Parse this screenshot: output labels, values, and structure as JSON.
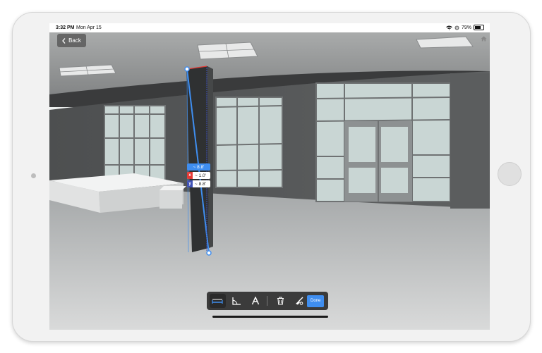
{
  "statusbar": {
    "time": "3:32 PM",
    "date": "Mon Apr 15",
    "battery": "79%",
    "icons": [
      "wifi-icon",
      "rotation-lock-icon",
      "battery-icon"
    ]
  },
  "back_button": {
    "label": "Back",
    "icon": "chevron-left-icon"
  },
  "measurement": {
    "total": "~ 8.8'",
    "axes": [
      {
        "axis": "x",
        "value": "~ 1.0'",
        "color": "#e53935"
      },
      {
        "axis": "y",
        "value": "~ 8.8'",
        "color": "#3f51b5"
      }
    ]
  },
  "toolbar": {
    "tools": [
      {
        "name": "distance-tool",
        "icon": "ruler-icon",
        "active": true
      },
      {
        "name": "angle-tool",
        "icon": "angle-icon",
        "active": false
      },
      {
        "name": "annotation-tool",
        "icon": "text-a-icon",
        "active": false
      },
      {
        "name": "delete-tool",
        "icon": "trash-icon",
        "active": false
      },
      {
        "name": "clear-all-tool",
        "icon": "broom-icon",
        "active": false
      }
    ],
    "done_label": "Done"
  },
  "colors": {
    "accent": "#3f8ef0",
    "toolbar": "#3b3b3b"
  }
}
